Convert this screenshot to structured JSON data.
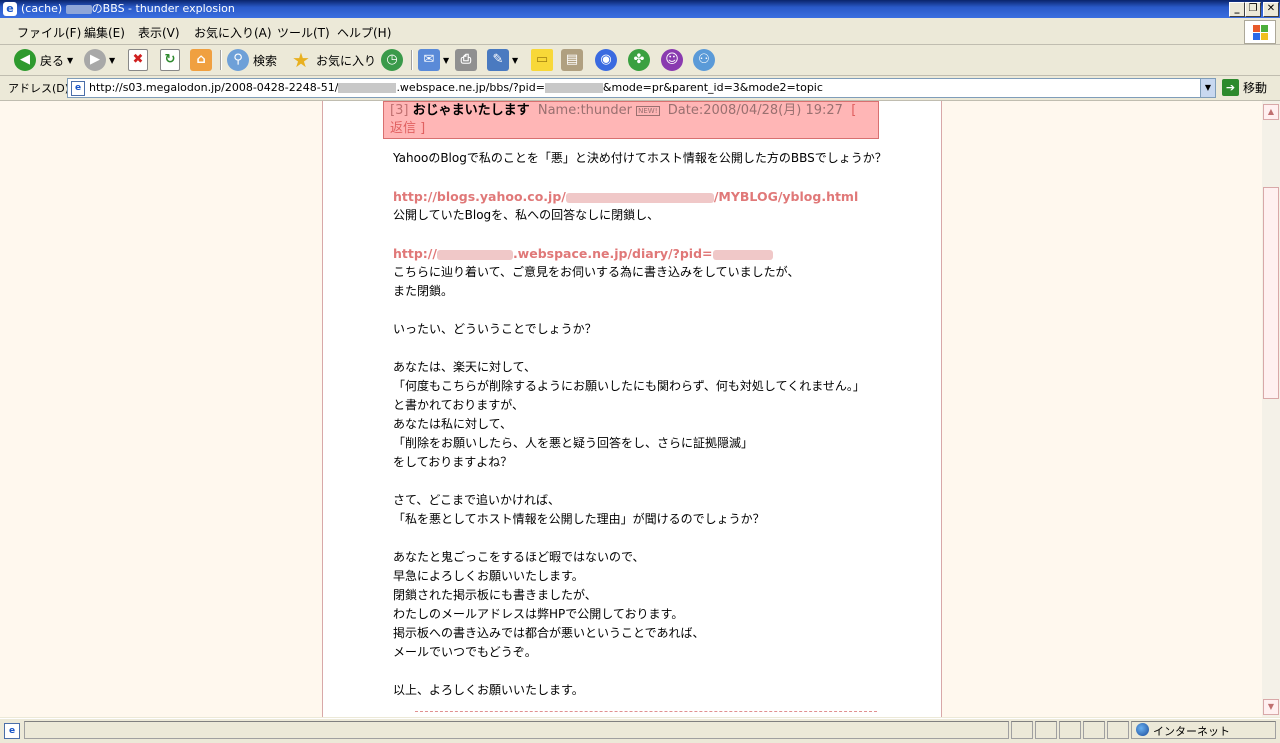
{
  "window": {
    "title_prefix": "(cache)",
    "title_suffix": "のBBS - thunder explosion",
    "minimize": "_",
    "maximize": "❐",
    "close": "✕"
  },
  "menu": [
    "ファイル(F)",
    "編集(E)",
    "表示(V)",
    "お気に入り(A)",
    "ツール(T)",
    "ヘルプ(H)"
  ],
  "toolbar": {
    "back": "戻る",
    "search": "検索",
    "favorites": "お気に入り"
  },
  "address": {
    "label": "アドレス(D)",
    "url_part1": "http://s03.megalodon.jp/2008-0428-2248-51/",
    "url_part2": ".webspace.ne.jp/bbs/?pid=",
    "url_part3": "&mode=pr&parent_id=3&mode2=topic",
    "go": "移動"
  },
  "post": {
    "number": "[3]",
    "subject": "おじゃまいたします",
    "name_label": "Name:thunder",
    "new_badge": "NEW!",
    "date_label": "Date:2008/04/28(月) 19:27",
    "reply": "[ 返信 ]",
    "lines": {
      "l1": "YahooのBlogで私のことを「悪」と決め付けてホスト情報を公開した方のBBSでしょうか？",
      "link1_prefix": "http://blogs.yahoo.co.jp/",
      "link1_suffix": "/MYBLOG/yblog.html",
      "l3": "公開していたBlogを、私への回答なしに閉鎖し、",
      "link2_prefix": "http://",
      "link2_suffix": ".webspace.ne.jp/diary/?pid=",
      "l5": "こちらに辿り着いて、ご意見をお伺いする為に書き込みをしていましたが、",
      "l6": "また閉鎖。",
      "l7": "いったい、どういうことでしょうか？",
      "l8": "あなたは、楽天に対して、",
      "l9": "「何度もこちらが削除するようにお願いしたにも関わらず、何も対処してくれません。」",
      "l10": "と書かれておりますが、",
      "l11": "あなたは私に対して、",
      "l12": "「削除をお願いしたら、人を悪と疑う回答をし、さらに証拠隠滅」",
      "l13": "をしておりますよね？",
      "l14": "さて、どこまで追いかければ、",
      "l15": "「私を悪としてホスト情報を公開した理由」が聞けるのでしょうか？",
      "l16": "あなたと鬼ごっこをするほど暇ではないので、",
      "l17": "早急によろしくお願いいたします。",
      "l18": "閉鎖された掲示板にも書きましたが、",
      "l19": "わたしのメールアドレスは弊HPで公開しております。",
      "l20": "掲示板への書き込みでは都合が悪いということであれば、",
      "l21": "メールでいつでもどうぞ。",
      "l22": "以上、よろしくお願いいたします。"
    }
  },
  "statusbar": {
    "zone": "インターネット"
  },
  "icons": [
    "ie-icon",
    "back-icon",
    "forward-icon",
    "stop-icon",
    "refresh-icon",
    "home-icon",
    "search-icon",
    "favorites-star-icon",
    "history-icon",
    "mail-icon",
    "print-icon",
    "edit-icon",
    "note-icon",
    "messenger-icon",
    "globe-icon",
    "xp-logo-icon",
    "go-icon"
  ]
}
